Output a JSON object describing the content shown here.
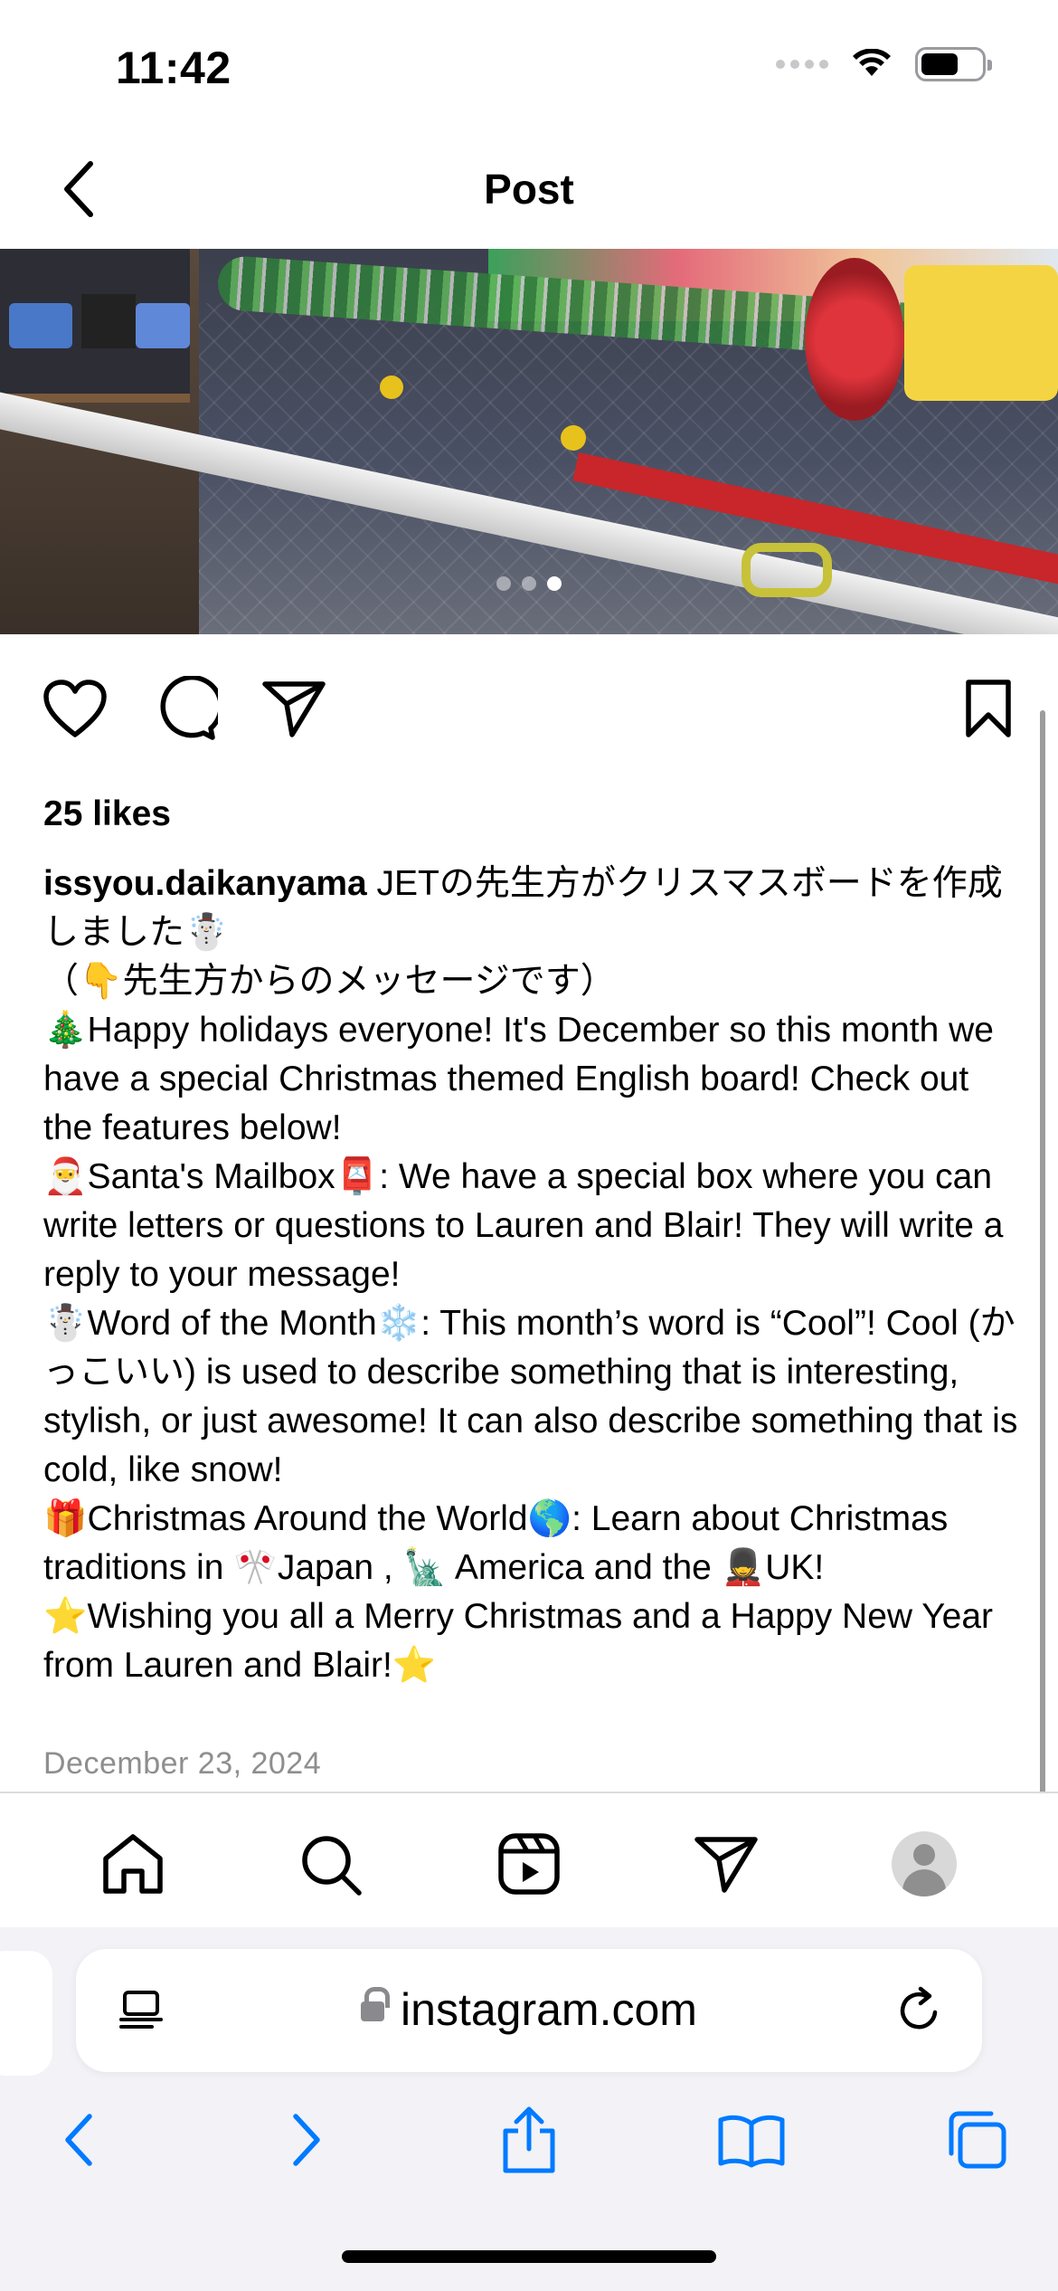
{
  "status_bar": {
    "time": "11:42"
  },
  "header": {
    "title": "Post"
  },
  "carousel": {
    "total_images": 3,
    "active_index": 3
  },
  "actions": {
    "like": "heart-icon",
    "comment": "comment-icon",
    "share": "send-icon",
    "save": "bookmark-icon"
  },
  "post": {
    "likes": "25 likes",
    "username": "issyou.daikanyama",
    "caption_first": " JETの先生方がクリスマスボードを作成しました☃️",
    "caption_lines": [
      "（👇先生方からのメッセージです）",
      "🎄Happy holidays everyone! It's December so this month we have a special Christmas themed English board! Check out the features below!",
      "🎅Santa's Mailbox📮: We have a special box where you can write letters or questions to Lauren and Blair! They will write a reply to your message!",
      "☃️Word of the Month❄️: This month’s word is “Cool”! Cool (かっこいい) is used to describe something that is interesting, stylish, or just awesome! It can also describe something that is cold, like snow!",
      "🎁Christmas Around the World🌎: Learn about Christmas traditions in 🎌Japan , 🗽 America and the 💂UK!",
      "⭐Wishing you all a Merry Christmas and a Happy New Year from Lauren and Blair!⭐"
    ],
    "date": "December 23, 2024"
  },
  "tabbar": {
    "items": [
      "home-icon",
      "search-icon",
      "reels-icon",
      "direct-icon",
      "profile-avatar"
    ]
  },
  "browser": {
    "url": "instagram.com",
    "toolbar": [
      "back-icon",
      "forward-icon",
      "share-icon",
      "bookmarks-icon",
      "tabs-icon"
    ],
    "accent": "#007aff"
  }
}
